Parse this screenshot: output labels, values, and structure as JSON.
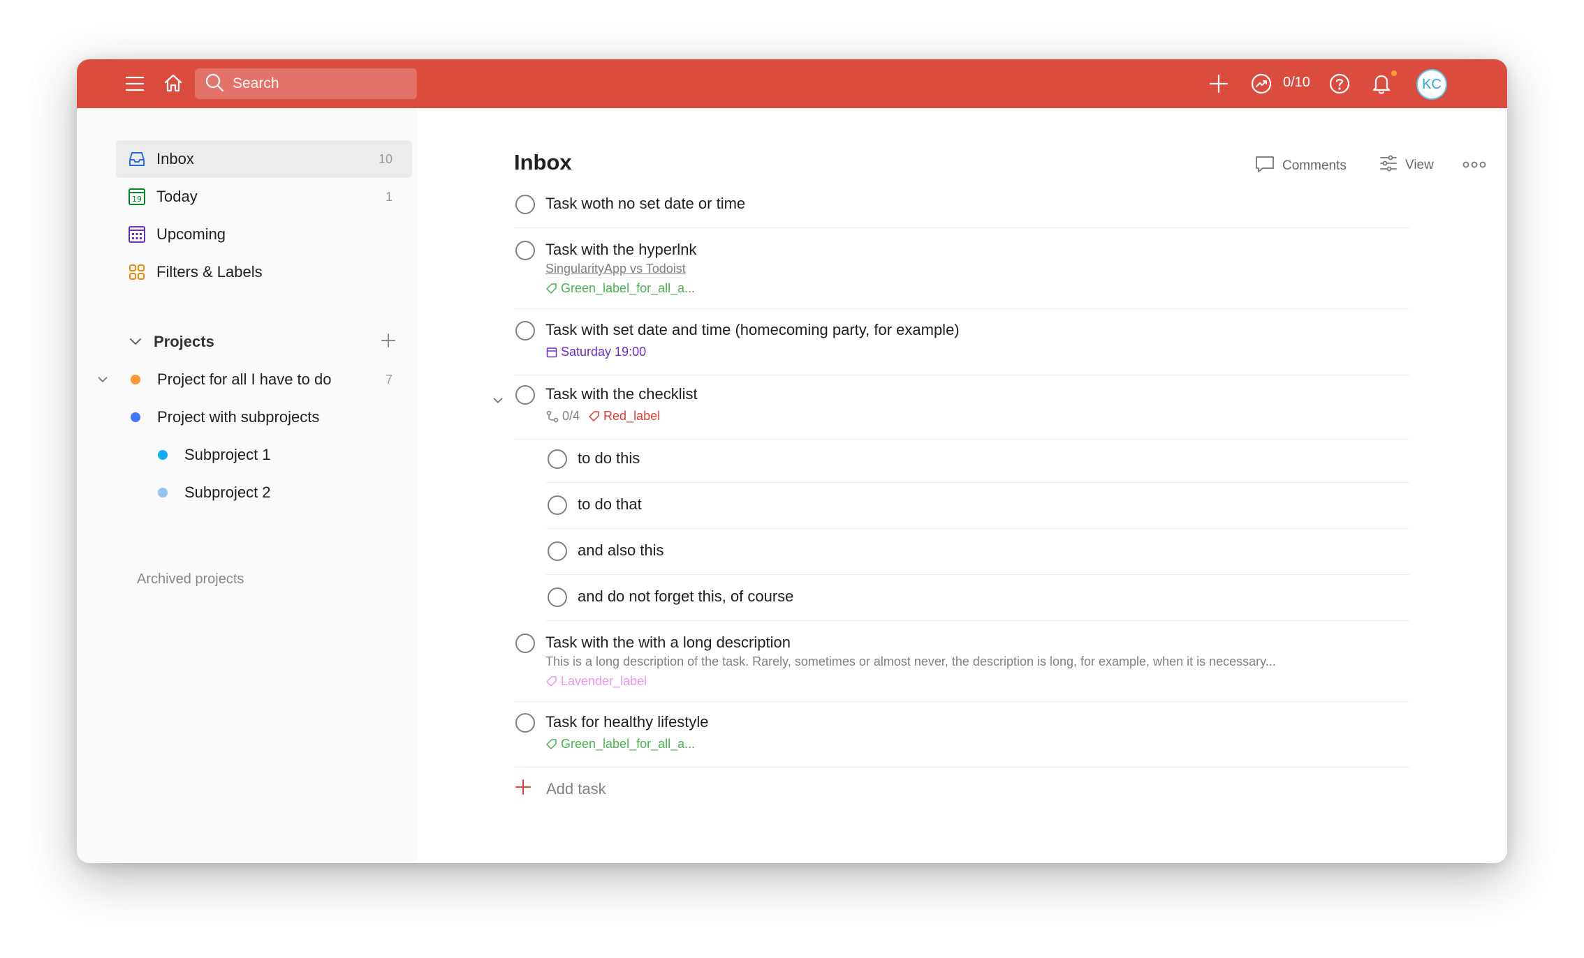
{
  "topbar": {
    "search_placeholder": "Search",
    "karma": "0/10",
    "avatar_initials": "KC",
    "bg_color": "#db4c3f"
  },
  "sidebar": {
    "nav": [
      {
        "label": "Inbox",
        "count": "10",
        "icon": "inbox-icon",
        "color": "#246fe0"
      },
      {
        "label": "Today",
        "count": "1",
        "icon": "calendar-today-icon",
        "color": "#058527",
        "day": "19"
      },
      {
        "label": "Upcoming",
        "count": "",
        "icon": "calendar-upcoming-icon",
        "color": "#692fc2"
      },
      {
        "label": "Filters & Labels",
        "count": "",
        "icon": "filters-icon",
        "color": "#eb8909"
      }
    ],
    "projects_heading": "Projects",
    "projects": [
      {
        "label": "Project for all I have to do",
        "count": "7",
        "color": "#ff9933"
      },
      {
        "label": "Project with subprojects",
        "count": "",
        "color": "#4073ff"
      },
      {
        "label": "Subproject 1",
        "count": "",
        "color": "#14aaf5"
      },
      {
        "label": "Subproject 2",
        "count": "",
        "color": "#96c3eb"
      }
    ],
    "archived": "Archived projects"
  },
  "main": {
    "title": "Inbox",
    "actions": {
      "comments": "Comments",
      "view": "View"
    },
    "tasks": [
      {
        "title": "Task woth no set date or time"
      },
      {
        "title": "Task with the hyperlnk",
        "link": "SingularityApp vs Todoist",
        "label": "Green_label_for_all_a..."
      },
      {
        "title": "Task with set date and time (homecoming party, for example)",
        "date": "Saturday 19:00"
      },
      {
        "title": "Task with the checklist",
        "subtasks_count": "0/4",
        "label": "Red_label",
        "subtasks": [
          "to do this",
          "to do that",
          "and also this",
          "and do not forget this, of course"
        ]
      },
      {
        "title": "Task with the with a long description",
        "description": "This is a long description of the task. Rarely, sometimes or almost never, the description is long, for example, when it is necessary...",
        "label": "Lavender_label"
      },
      {
        "title": "Task for healthy lifestyle",
        "label": "Green_label_for_all_a..."
      }
    ],
    "add_task": "Add task"
  }
}
